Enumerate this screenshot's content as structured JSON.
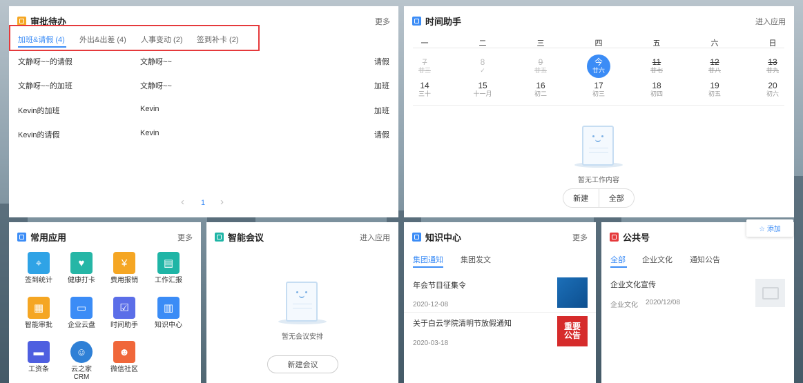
{
  "approval": {
    "title": "审批待办",
    "more": "更多",
    "tabs": [
      {
        "label": "加班&请假 (4)",
        "active": true
      },
      {
        "label": "外出&出差 (4)"
      },
      {
        "label": "人事变动 (2)"
      },
      {
        "label": "签到补卡 (2)"
      }
    ],
    "rows": [
      {
        "name": "文静呀~~的请假",
        "person": "文静呀~~",
        "type": "请假"
      },
      {
        "name": "文静呀~~的加班",
        "person": "文静呀~~",
        "type": "加班"
      },
      {
        "name": "Kevin的加班",
        "person": "Kevin",
        "type": "加班"
      },
      {
        "name": "Kevin的请假",
        "person": "Kevin",
        "type": "请假"
      }
    ],
    "pager": {
      "prev": "‹",
      "page": "1",
      "next": "›"
    }
  },
  "timehelper": {
    "title": "时间助手",
    "enter": "进入应用",
    "weekdays": [
      "一",
      "二",
      "三",
      "四",
      "五",
      "六",
      "日"
    ],
    "week1": [
      {
        "n": "7",
        "l": "廿三",
        "past": true
      },
      {
        "n": "8",
        "l": "✓",
        "past": true
      },
      {
        "n": "9",
        "l": "廿五",
        "past": true
      },
      {
        "n": "今",
        "l": "廿六",
        "today": true
      },
      {
        "n": "11",
        "l": "廿七",
        "past": true
      },
      {
        "n": "12",
        "l": "廿八",
        "past": true
      },
      {
        "n": "13",
        "l": "廿九",
        "past": true
      }
    ],
    "week2": [
      {
        "n": "14",
        "l": "三十"
      },
      {
        "n": "15",
        "l": "十一月"
      },
      {
        "n": "16",
        "l": "初二"
      },
      {
        "n": "17",
        "l": "初三"
      },
      {
        "n": "18",
        "l": "初四"
      },
      {
        "n": "19",
        "l": "初五"
      },
      {
        "n": "20",
        "l": "初六"
      }
    ],
    "empty": "暂无工作内容",
    "btn_new": "新建",
    "btn_all": "全部"
  },
  "apps": {
    "title": "常用应用",
    "more": "更多",
    "items": [
      {
        "label": "签到统计",
        "icon": "location-icon",
        "color": "#2fa3e6"
      },
      {
        "label": "健康打卡",
        "icon": "heartbeat-icon",
        "color": "#26b6a6"
      },
      {
        "label": "费用报销",
        "icon": "yen-icon",
        "color": "#f5a623"
      },
      {
        "label": "工作汇报",
        "icon": "report-chart-icon",
        "color": "#1fb5a6"
      },
      {
        "label": "智能审批",
        "icon": "approval-doc-icon",
        "color": "#f5a623"
      },
      {
        "label": "企业云盘",
        "icon": "folder-icon",
        "color": "#3b8cf6"
      },
      {
        "label": "时间助手",
        "icon": "calendar-check-icon",
        "color": "#5b6ee8"
      },
      {
        "label": "知识中心",
        "icon": "book-icon",
        "color": "#3b8cf6"
      },
      {
        "label": "工资条",
        "icon": "payslip-icon",
        "color": "#4e5fe0"
      },
      {
        "label": "云之家CRM",
        "icon": "crm-person-icon",
        "color": "#2f80d6"
      },
      {
        "label": "微信社区",
        "icon": "community-people-icon",
        "color": "#f0673a"
      }
    ]
  },
  "meeting": {
    "title": "智能会议",
    "enter": "进入应用",
    "empty": "暂无会议安排",
    "new_btn": "新建会议"
  },
  "knowledge": {
    "title": "知识中心",
    "more": "更多",
    "tabs": [
      "集团通知",
      "集团发文"
    ],
    "news": [
      {
        "title": "年会节目征集令",
        "date": "2020-12-08"
      },
      {
        "title": "关于白云学院清明节放假通知",
        "date": "2020-03-18"
      }
    ],
    "thumb2_text": "重要公告"
  },
  "public": {
    "title": "公共号",
    "add": "☆ 添加",
    "tabs": [
      "全部",
      "企业文化",
      "通知公告"
    ],
    "post": {
      "title": "企业文化宣传",
      "category": "企业文化",
      "date": "2020/12/08"
    }
  },
  "colors": {
    "accent": "#3b8cf6",
    "highlight_border": "#e5393b"
  }
}
